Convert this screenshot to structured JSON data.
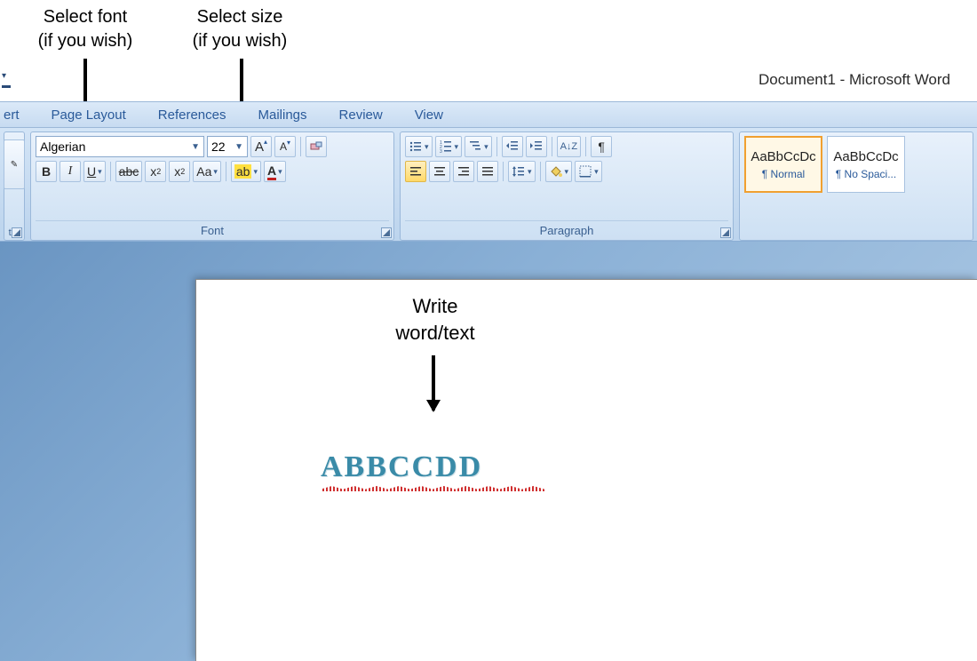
{
  "annotations": {
    "font": "Select font\n(if you wish)",
    "size": "Select size\n(if you wish)",
    "write": "Write\nword/text"
  },
  "title": "Document1 - Microsoft Word",
  "tabs": {
    "insert_partial": "ert",
    "pageLayout": "Page Layout",
    "references": "References",
    "mailings": "Mailings",
    "review": "Review",
    "view": "View"
  },
  "clipboard": {
    "title_partial": "ter"
  },
  "font": {
    "fontName": "Algerian",
    "fontSize": "22",
    "title": "Font",
    "bold": "B",
    "italic": "I",
    "underline": "U",
    "strike": "abc",
    "sub": "x",
    "sup": "x",
    "caseBtn": "Aa",
    "growA": "A",
    "shrinkA": "A",
    "highlight": "ab"
  },
  "paragraph": {
    "title": "Paragraph",
    "sortLabel": "A↓Z",
    "pilcrow": "¶"
  },
  "styles": {
    "preview1": "AaBbCcDc",
    "label1": "¶ Normal",
    "preview2": "AaBbCcDc",
    "label2": "¶ No Spaci..."
  },
  "document": {
    "text": "ABBCCDD"
  }
}
